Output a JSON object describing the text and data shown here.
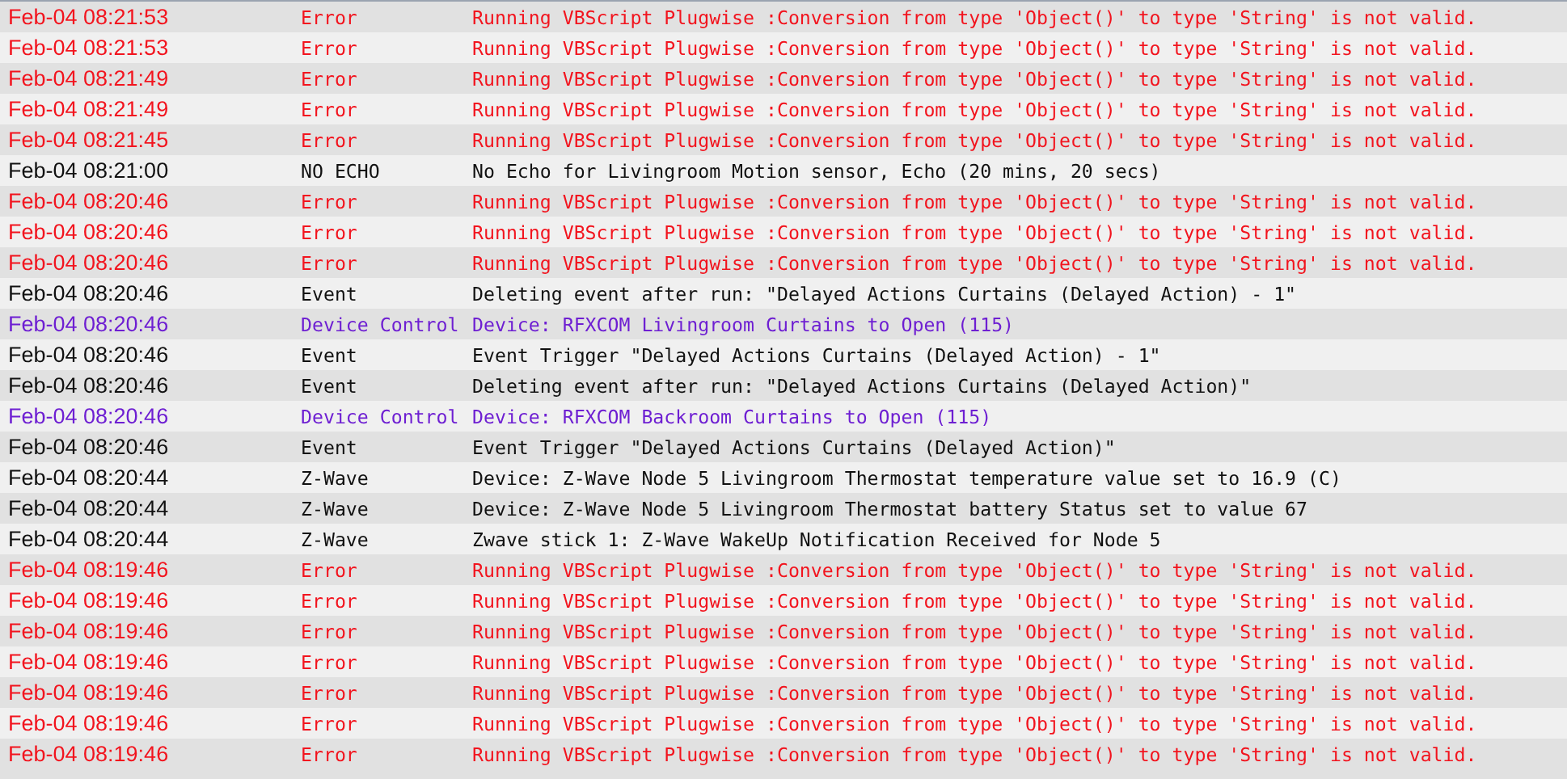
{
  "log": {
    "rows": [
      {
        "kind": "error",
        "time": "Feb-04 08:21:53",
        "type": "Error",
        "message": "Running VBScript Plugwise :Conversion from type 'Object()' to type 'String' is not valid."
      },
      {
        "kind": "error",
        "time": "Feb-04 08:21:53",
        "type": "Error",
        "message": "Running VBScript Plugwise :Conversion from type 'Object()' to type 'String' is not valid."
      },
      {
        "kind": "error",
        "time": "Feb-04 08:21:49",
        "type": "Error",
        "message": "Running VBScript Plugwise :Conversion from type 'Object()' to type 'String' is not valid."
      },
      {
        "kind": "error",
        "time": "Feb-04 08:21:49",
        "type": "Error",
        "message": "Running VBScript Plugwise :Conversion from type 'Object()' to type 'String' is not valid."
      },
      {
        "kind": "error",
        "time": "Feb-04 08:21:45",
        "type": "Error",
        "message": "Running VBScript Plugwise :Conversion from type 'Object()' to type 'String' is not valid."
      },
      {
        "kind": "info",
        "time": "Feb-04 08:21:00",
        "type": "NO ECHO",
        "message": "No Echo for Livingroom Motion sensor, Echo (20 mins, 20 secs)"
      },
      {
        "kind": "error",
        "time": "Feb-04 08:20:46",
        "type": "Error",
        "message": "Running VBScript Plugwise :Conversion from type 'Object()' to type 'String' is not valid."
      },
      {
        "kind": "error",
        "time": "Feb-04 08:20:46",
        "type": "Error",
        "message": "Running VBScript Plugwise :Conversion from type 'Object()' to type 'String' is not valid."
      },
      {
        "kind": "error",
        "time": "Feb-04 08:20:46",
        "type": "Error",
        "message": "Running VBScript Plugwise :Conversion from type 'Object()' to type 'String' is not valid."
      },
      {
        "kind": "info",
        "time": "Feb-04 08:20:46",
        "type": "Event",
        "message": "Deleting event after run: \"Delayed Actions Curtains (Delayed Action) - 1\""
      },
      {
        "kind": "device",
        "time": "Feb-04 08:20:46",
        "type": "Device Control",
        "message": "Device: RFXCOM Livingroom Curtains to Open (115)"
      },
      {
        "kind": "info",
        "time": "Feb-04 08:20:46",
        "type": "Event",
        "message": "Event Trigger \"Delayed Actions Curtains (Delayed Action) - 1\""
      },
      {
        "kind": "info",
        "time": "Feb-04 08:20:46",
        "type": "Event",
        "message": "Deleting event after run: \"Delayed Actions Curtains (Delayed Action)\""
      },
      {
        "kind": "device",
        "time": "Feb-04 08:20:46",
        "type": "Device Control",
        "message": "Device: RFXCOM Backroom Curtains to Open (115)"
      },
      {
        "kind": "info",
        "time": "Feb-04 08:20:46",
        "type": "Event",
        "message": "Event Trigger \"Delayed Actions Curtains (Delayed Action)\""
      },
      {
        "kind": "info",
        "time": "Feb-04 08:20:44",
        "type": "Z-Wave",
        "message": "Device: Z-Wave Node 5 Livingroom Thermostat temperature value set to 16.9 (C)"
      },
      {
        "kind": "info",
        "time": "Feb-04 08:20:44",
        "type": "Z-Wave",
        "message": "Device: Z-Wave Node 5 Livingroom Thermostat battery Status set to value 67"
      },
      {
        "kind": "info",
        "time": "Feb-04 08:20:44",
        "type": "Z-Wave",
        "message": "Zwave stick 1: Z-Wave WakeUp Notification Received for Node 5"
      },
      {
        "kind": "error",
        "time": "Feb-04 08:19:46",
        "type": "Error",
        "message": "Running VBScript Plugwise :Conversion from type 'Object()' to type 'String' is not valid."
      },
      {
        "kind": "error",
        "time": "Feb-04 08:19:46",
        "type": "Error",
        "message": "Running VBScript Plugwise :Conversion from type 'Object()' to type 'String' is not valid."
      },
      {
        "kind": "error",
        "time": "Feb-04 08:19:46",
        "type": "Error",
        "message": "Running VBScript Plugwise :Conversion from type 'Object()' to type 'String' is not valid."
      },
      {
        "kind": "error",
        "time": "Feb-04 08:19:46",
        "type": "Error",
        "message": "Running VBScript Plugwise :Conversion from type 'Object()' to type 'String' is not valid."
      },
      {
        "kind": "error",
        "time": "Feb-04 08:19:46",
        "type": "Error",
        "message": "Running VBScript Plugwise :Conversion from type 'Object()' to type 'String' is not valid."
      },
      {
        "kind": "error",
        "time": "Feb-04 08:19:46",
        "type": "Error",
        "message": "Running VBScript Plugwise :Conversion from type 'Object()' to type 'String' is not valid."
      },
      {
        "kind": "error",
        "time": "Feb-04 08:19:46",
        "type": "Error",
        "message": "Running VBScript Plugwise :Conversion from type 'Object()' to type 'String' is not valid."
      }
    ]
  }
}
